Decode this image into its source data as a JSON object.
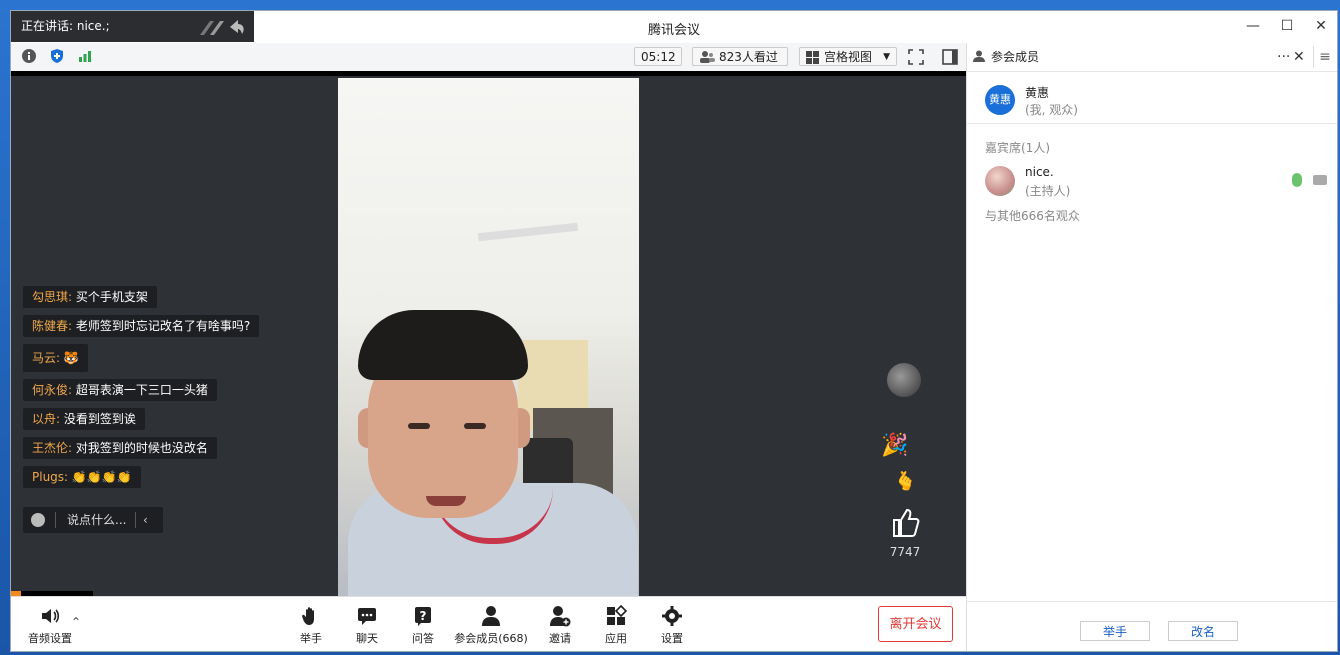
{
  "window": {
    "title": "腾讯会议",
    "controls": {
      "minimize": "—",
      "maximize": "☐",
      "close": "✕"
    }
  },
  "speaking": {
    "label": "正在讲话: nice.;"
  },
  "topbar": {
    "duration": "05:12",
    "viewers": "823人看过",
    "view_mode": "宫格视图"
  },
  "chat": {
    "messages": [
      {
        "user": "勾思琪:",
        "text": "买个手机支架"
      },
      {
        "user": "陈健春:",
        "text": "老师签到时忘记改名了有啥事吗?"
      },
      {
        "user": "马云:",
        "text": "🐯"
      },
      {
        "user": "何永俊:",
        "text": "超哥表演一下三口一头猪"
      },
      {
        "user": "以舟:",
        "text": "没看到签到诶"
      },
      {
        "user": "王杰伦:",
        "text": "对我签到的时候也没改名"
      },
      {
        "user": "Plugs:",
        "text": "👏👏👏👏"
      }
    ],
    "input_placeholder": "说点什么...",
    "collapse_icon": "chevron-left-icon"
  },
  "reactions": {
    "icons": [
      "party-popper-icon",
      "finger-heart-icon",
      "thumbs-up-icon"
    ],
    "like_count": "7747"
  },
  "bottom_bar": {
    "audio_settings": "音频设置",
    "raise_hand": "举手",
    "chat": "聊天",
    "qa": "问答",
    "participants": "参会成员(668)",
    "invite": "邀请",
    "apps": "应用",
    "settings": "设置",
    "leave": "离开会议"
  },
  "panel": {
    "title": "参会成员",
    "more": "···",
    "close": "✕",
    "me": {
      "avatar_text": "黄惠",
      "name": "黄惠",
      "role": "(我, 观众)"
    },
    "guest_section": "嘉宾席(1人)",
    "host": {
      "name": "nice.",
      "role": "(主持人)"
    },
    "others": "与其他666名观众",
    "footer": {
      "raise_hand": "举手",
      "rename": "改名"
    }
  },
  "colors": {
    "accent": "#1a5fc7",
    "leave": "#e53935",
    "chat_name": "#f0a84a",
    "video_bg": "#2e3135"
  }
}
